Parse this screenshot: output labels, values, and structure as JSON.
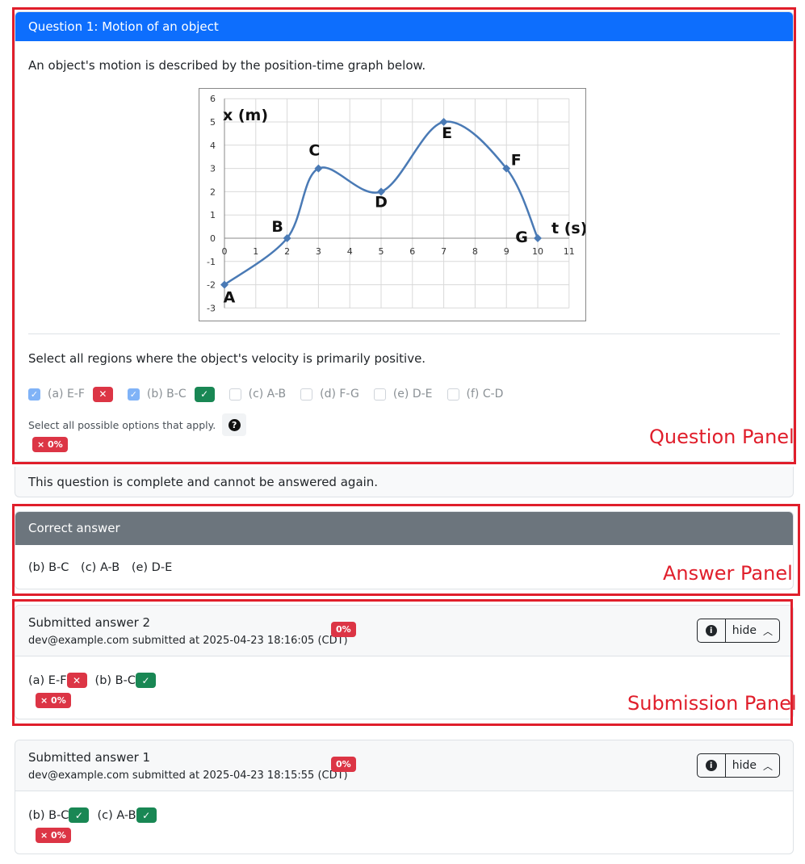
{
  "question": {
    "header": "Question 1: Motion of an object",
    "intro": "An object's motion is described by the position-time graph below.",
    "prompt": "Select all regions where the object's velocity is primarily positive.",
    "options": [
      {
        "label": "(a)  E-F",
        "checked": true,
        "mark": "wrong"
      },
      {
        "label": "(b)  B-C",
        "checked": true,
        "mark": "right"
      },
      {
        "label": "(c)  A-B",
        "checked": false
      },
      {
        "label": "(d)  F-G",
        "checked": false
      },
      {
        "label": "(e)  D-E",
        "checked": false
      },
      {
        "label": "(f)   C-D",
        "checked": false
      }
    ],
    "help_text": "Select all possible options that apply.",
    "score": "× 0%",
    "complete_text": "This question is complete and cannot be answered again."
  },
  "graph": {
    "y_label": "x (m)",
    "x_label": "t (s)",
    "x_ticks": [
      "0",
      "1",
      "2",
      "3",
      "4",
      "5",
      "6",
      "7",
      "8",
      "9",
      "10",
      "11"
    ],
    "y_ticks": [
      "6",
      "5",
      "4",
      "3",
      "2",
      "1",
      "0",
      "-1",
      "-2",
      "-3"
    ],
    "points": [
      {
        "name": "A",
        "t": 0,
        "x": -2
      },
      {
        "name": "B",
        "t": 2,
        "x": 0
      },
      {
        "name": "C",
        "t": 3,
        "x": 3
      },
      {
        "name": "D",
        "t": 5,
        "x": 2
      },
      {
        "name": "E",
        "t": 7,
        "x": 5
      },
      {
        "name": "F",
        "t": 9,
        "x": 3
      },
      {
        "name": "G",
        "t": 10,
        "x": 0
      }
    ],
    "line_color": "#4a7ab5"
  },
  "answer": {
    "header": "Correct answer",
    "items": [
      "(b) B-C",
      "(c) A-B",
      "(e) D-E"
    ]
  },
  "submissions": [
    {
      "title": "Submitted answer 2",
      "meta": "dev@example.com submitted at 2025-04-23 18:16:05 (CDT)",
      "score": "0%",
      "button": "hide",
      "items": [
        {
          "label": "(a) E-F",
          "mark": "wrong"
        },
        {
          "label": "(b) B-C",
          "mark": "right"
        }
      ],
      "footer_score": "× 0%"
    },
    {
      "title": "Submitted answer 1",
      "meta": "dev@example.com submitted at 2025-04-23 18:15:55 (CDT)",
      "score": "0%",
      "button": "hide",
      "items": [
        {
          "label": "(b) B-C",
          "mark": "right"
        },
        {
          "label": "(c) A-B",
          "mark": "right"
        }
      ],
      "footer_score": "× 0%"
    }
  ],
  "annotations": {
    "question_panel": "Question Panel",
    "answer_panel": "Answer Panel",
    "submission_panel": "Submission Panel"
  },
  "colors": {
    "primary": "#0d6efd",
    "danger": "#dc3545",
    "success": "#198754",
    "secondary": "#6c757d",
    "annotation": "#e01e2b"
  }
}
